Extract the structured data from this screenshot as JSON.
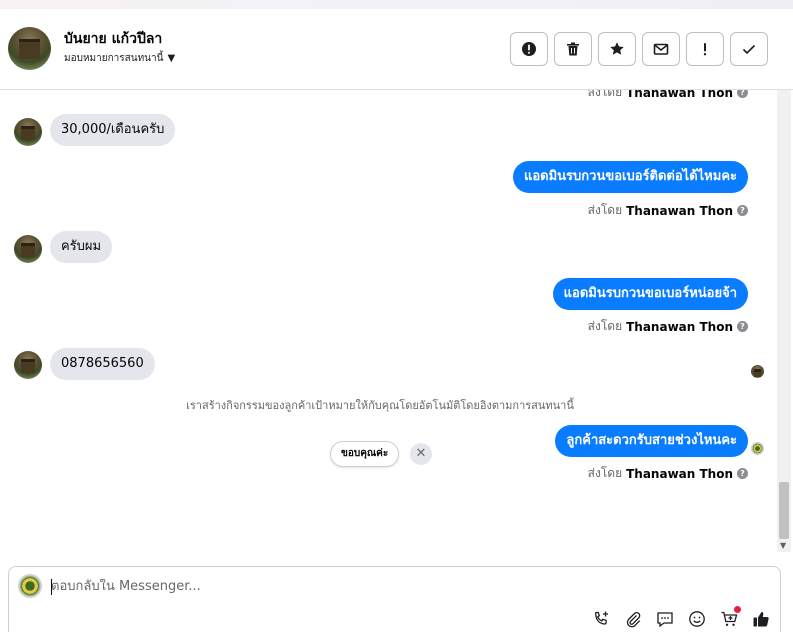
{
  "header": {
    "contact_name": "บันยาย แก้วปีลา",
    "assign_label": "มอบหมายการสนทนานี้",
    "buttons": [
      {
        "name": "spam-button",
        "icon": "alert-circle-icon"
      },
      {
        "name": "delete-button",
        "icon": "trash-icon"
      },
      {
        "name": "star-button",
        "icon": "star-icon"
      },
      {
        "name": "mark-unread-button",
        "icon": "envelope-icon"
      },
      {
        "name": "follow-up-button",
        "icon": "exclamation-icon"
      },
      {
        "name": "mark-done-button",
        "icon": "check-icon"
      }
    ]
  },
  "thread": {
    "sent_by_prefix": "ส่งโดย",
    "agent_name": "Thanawan Thon",
    "messages": [
      {
        "dir": "in",
        "text": "30,000/เดือนครับ"
      },
      {
        "dir": "out",
        "text": "แอดมินรบกวนขอเบอร์ติดต่อได้ไหมคะ"
      },
      {
        "dir": "in",
        "text": "ครับผม"
      },
      {
        "dir": "out",
        "text": "แอดมินรบกวนขอเบอร์หน่อยจ้า"
      },
      {
        "dir": "in",
        "text": "0878656560"
      },
      {
        "dir": "out",
        "text": "ลูกค้าสะดวกรับสายช่วงไหนคะ"
      }
    ],
    "system_note": "เราสร้างกิจกรรมของลูกค้าเป้าหมายให้กับคุณโดยอัตโนมัติโดยอิงตามการสนทนานี้",
    "quick_reply": "ขอบคุณค่ะ",
    "quick_reply_close": "✕"
  },
  "composer": {
    "placeholder": "ตอบกลับใน Messenger...",
    "tools": [
      "phone-plus-icon",
      "paperclip-icon",
      "saved-reply-icon",
      "emoji-icon",
      "cart-icon",
      "thumbs-up-icon"
    ]
  },
  "colors": {
    "outgoing_bubble": "#0a7cff",
    "incoming_bubble": "#e4e6eb",
    "meta_text": "#65676b"
  }
}
